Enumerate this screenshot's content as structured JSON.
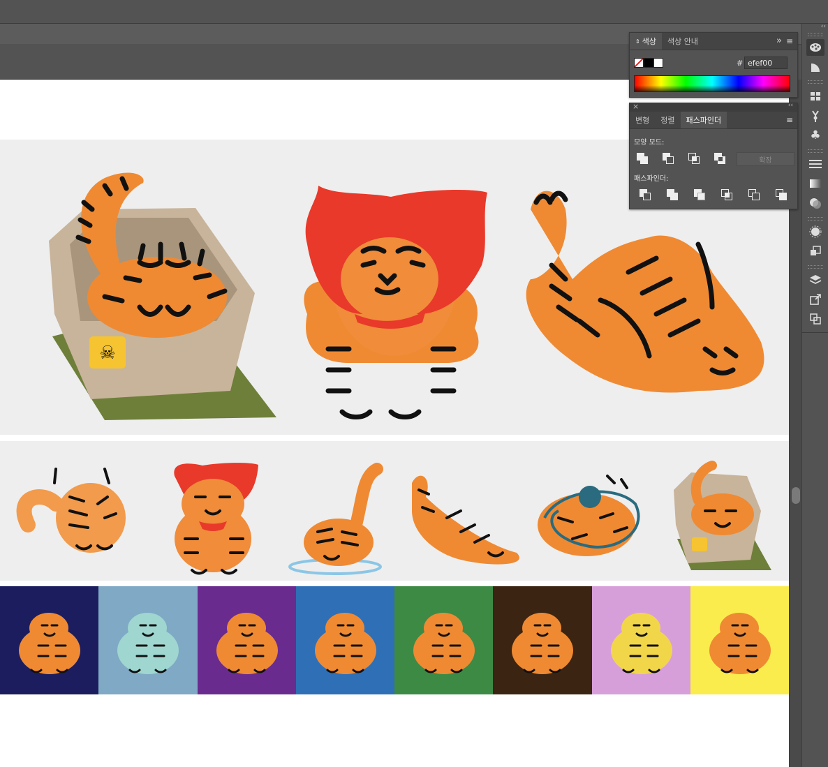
{
  "color_panel": {
    "tabs": [
      "색상",
      "색상 안내"
    ],
    "hex_prefix": "#",
    "hex_value": "efef00",
    "overflow": "»",
    "menu": "≡"
  },
  "pathfinder_panel": {
    "tabs": [
      "변형",
      "정렬",
      "패스파인더"
    ],
    "shape_modes_label": "모양 모드:",
    "expand_button": "확장",
    "pathfinders_label": "패스파인더:",
    "close": "×",
    "collapse": "‹‹",
    "menu": "≡"
  },
  "dock": {
    "collapse": "‹‹",
    "icons": [
      "color-palette-icon",
      "color-guide-icon",
      "swatches-icon",
      "brushes-icon",
      "symbols-icon",
      "stroke-icon",
      "gradient-icon",
      "transparency-icon",
      "appearance-icon",
      "graphic-styles-icon",
      "layers-icon",
      "export-icon",
      "artboards-icon"
    ]
  },
  "colors": {
    "orange": "#ef8a33",
    "red": "#e8392a",
    "box": "#c8b49a",
    "mat": "#6e7f3a",
    "tile_bgs": [
      "#1c1d5e",
      "#7fa9c4",
      "#6a2b8f",
      "#2f6fb5",
      "#3d8a45",
      "#3b2412",
      "#d79fd9",
      "#f9ec4c"
    ]
  },
  "canvas": {
    "rows": 3
  }
}
